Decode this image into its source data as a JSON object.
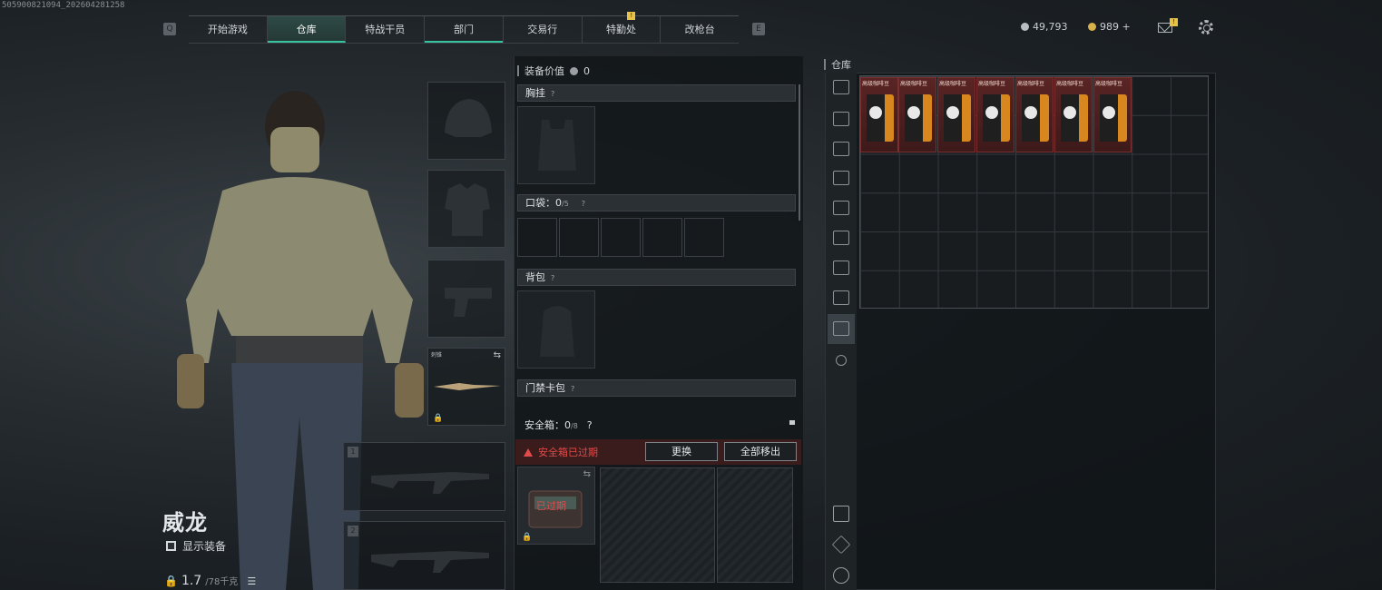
{
  "session_id": "505900821094_202604281258",
  "nav": {
    "left_key": "Q",
    "right_key": "E",
    "tabs": [
      {
        "label": "开始游戏"
      },
      {
        "label": "仓库"
      },
      {
        "label": "特战干员"
      },
      {
        "label": "部门"
      },
      {
        "label": "交易行"
      },
      {
        "label": "特勤处",
        "badge": "!"
      },
      {
        "label": "改枪台"
      }
    ]
  },
  "currency": {
    "silver": "49,793",
    "gold": "989 +"
  },
  "mail_badge": "!",
  "character": {
    "name": "威龙",
    "show_gear_label": "显示装备",
    "weight_value": "1.7",
    "weight_max": "/78千克"
  },
  "slots": {
    "melee_label": "刺锥",
    "weapon1_number": "1",
    "weapon2_number": "2"
  },
  "middle": {
    "value_label": "装备价值",
    "value_amount": "0",
    "chest_rig": "胸挂",
    "pockets_label": "口袋：",
    "pockets_used": "0",
    "pockets_total": "/5",
    "backpack": "背包",
    "keycard": "门禁卡包",
    "help_mark": "?",
    "safe_label": "安全箱：",
    "safe_used": "0",
    "safe_total": "/8",
    "expired_warning": "安全箱已过期",
    "replace_button": "更换",
    "remove_all_button": "全部移出",
    "case_expired_tag": "已过期"
  },
  "stash": {
    "title": "仓库",
    "items": [
      {
        "label": "高级咖啡豆"
      },
      {
        "label": "高级咖啡豆"
      },
      {
        "label": "高级咖啡豆"
      },
      {
        "label": "高级咖啡豆"
      },
      {
        "label": "高级咖啡豆"
      },
      {
        "label": "高级咖啡豆"
      },
      {
        "label": "高级咖啡豆"
      }
    ]
  },
  "colors": {
    "accent": "#37c3a0",
    "warning": "#e24b4b",
    "item_bg": "#5a2424",
    "badge": "#e6c24a"
  }
}
